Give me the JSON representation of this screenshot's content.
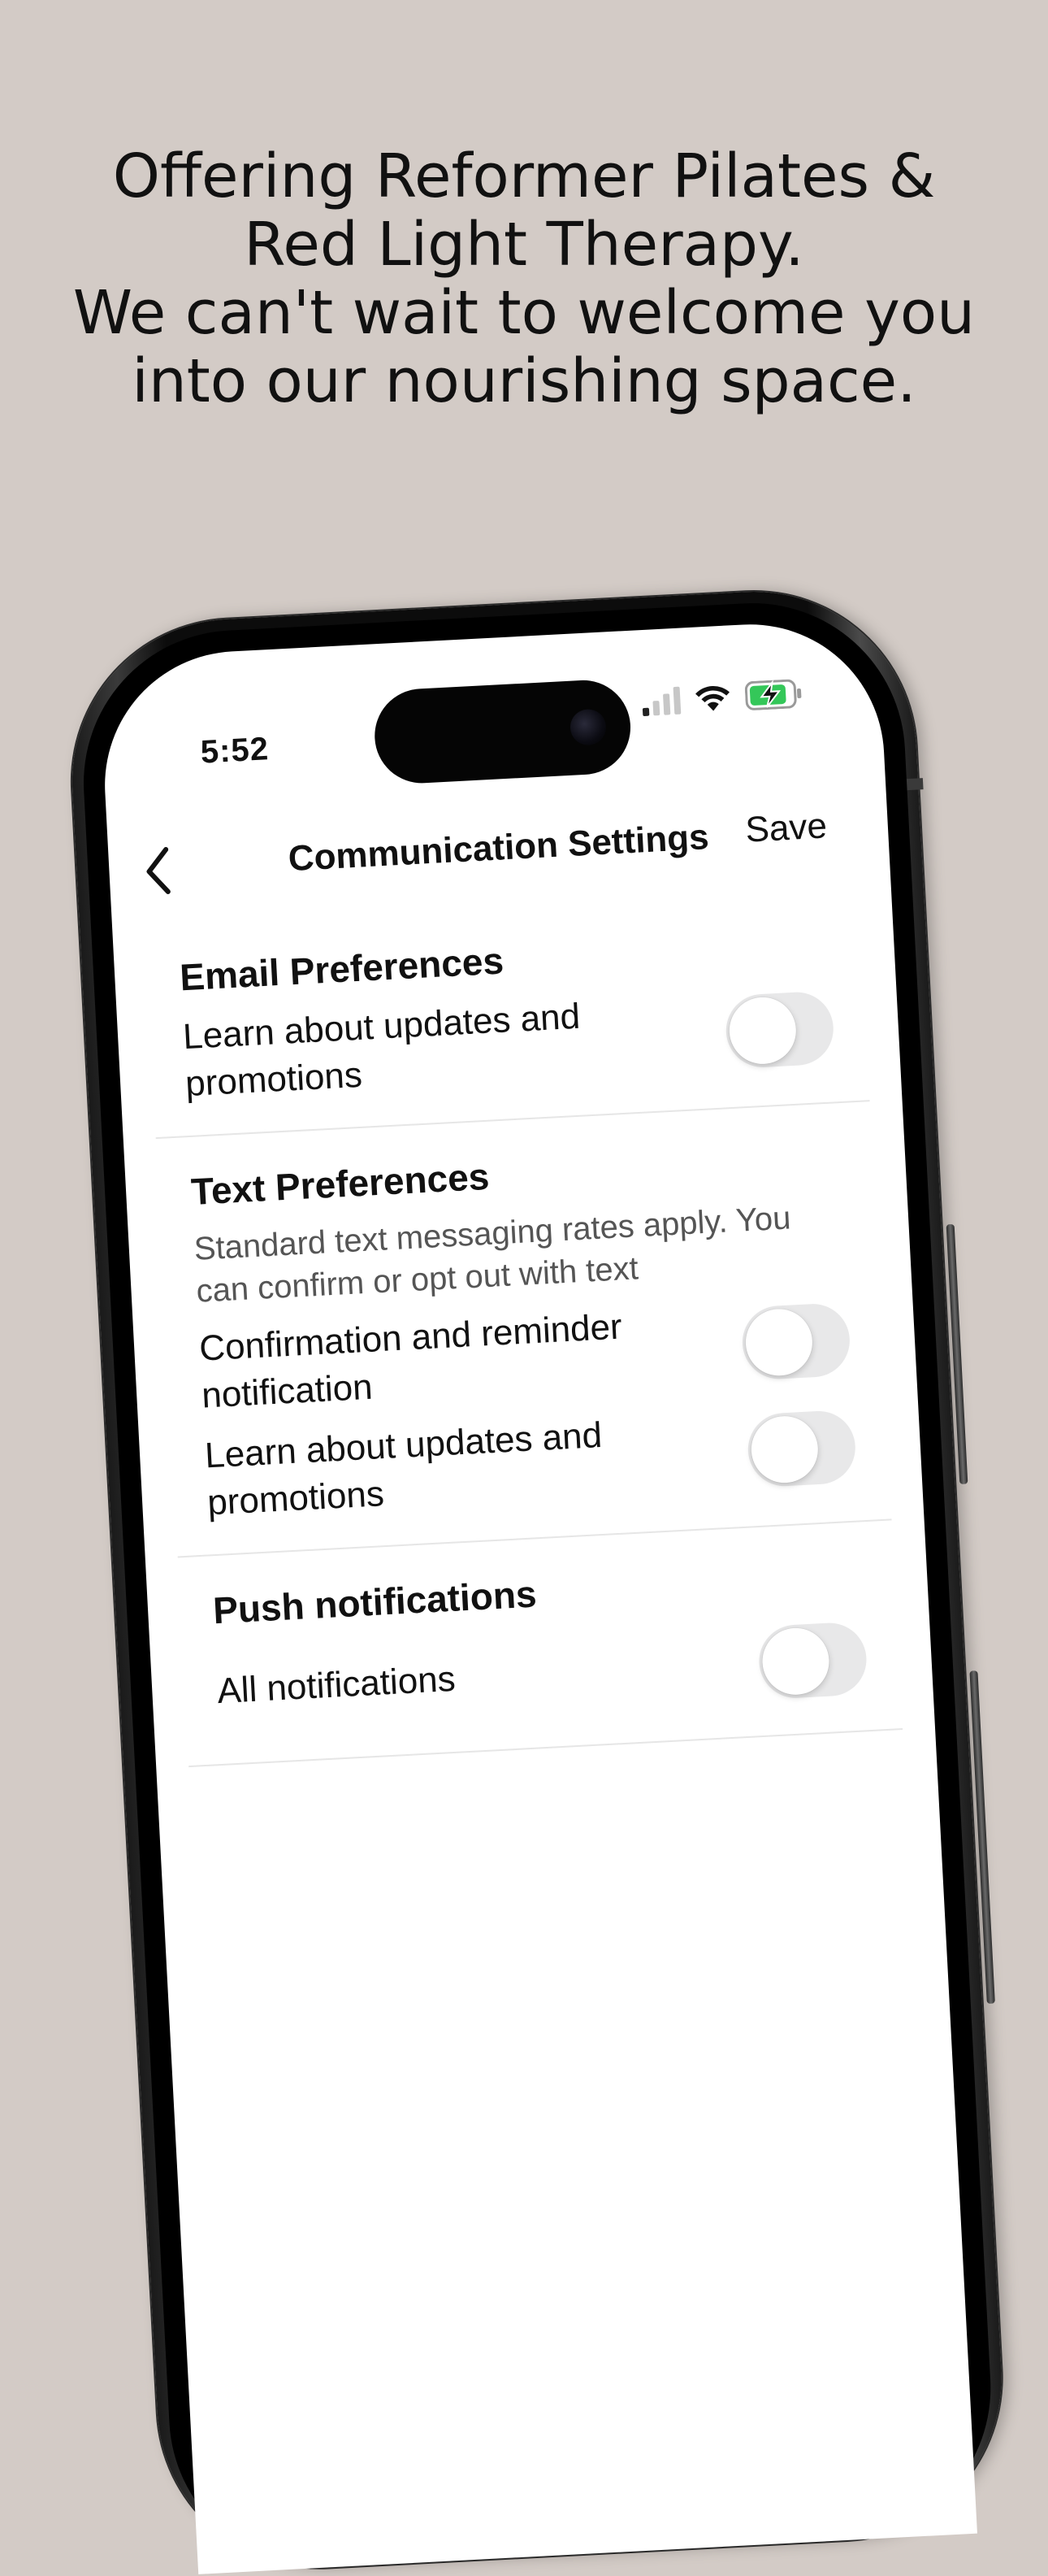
{
  "promo": {
    "line1": "Offering Reformer Pilates &",
    "line2": "Red Light Therapy.",
    "line3": "We can't wait to welcome you",
    "line4": "into our nourishing space."
  },
  "status_bar": {
    "time": "5:52",
    "icons": [
      "cellular-signal-icon",
      "wifi-icon",
      "battery-charging-icon"
    ]
  },
  "nav": {
    "back_icon": "chevron-left-icon",
    "title": "Communication Settings",
    "save_label": "Save"
  },
  "sections": {
    "email": {
      "title": "Email Preferences",
      "rows": [
        {
          "label": "Learn about updates and promotions",
          "enabled": false
        }
      ]
    },
    "text": {
      "title": "Text Preferences",
      "description": "Standard text messaging rates apply. You can confirm or opt out with text",
      "rows": [
        {
          "label": "Confirmation and reminder notification",
          "enabled": false
        },
        {
          "label": "Learn about updates and promotions",
          "enabled": false
        }
      ]
    },
    "push": {
      "title": "Push notifications",
      "rows": [
        {
          "label": "All notifications",
          "enabled": false
        }
      ]
    }
  },
  "colors": {
    "background": "#d3cbc6",
    "toggle_off": "#e8e8e9",
    "battery_green": "#34c759"
  }
}
